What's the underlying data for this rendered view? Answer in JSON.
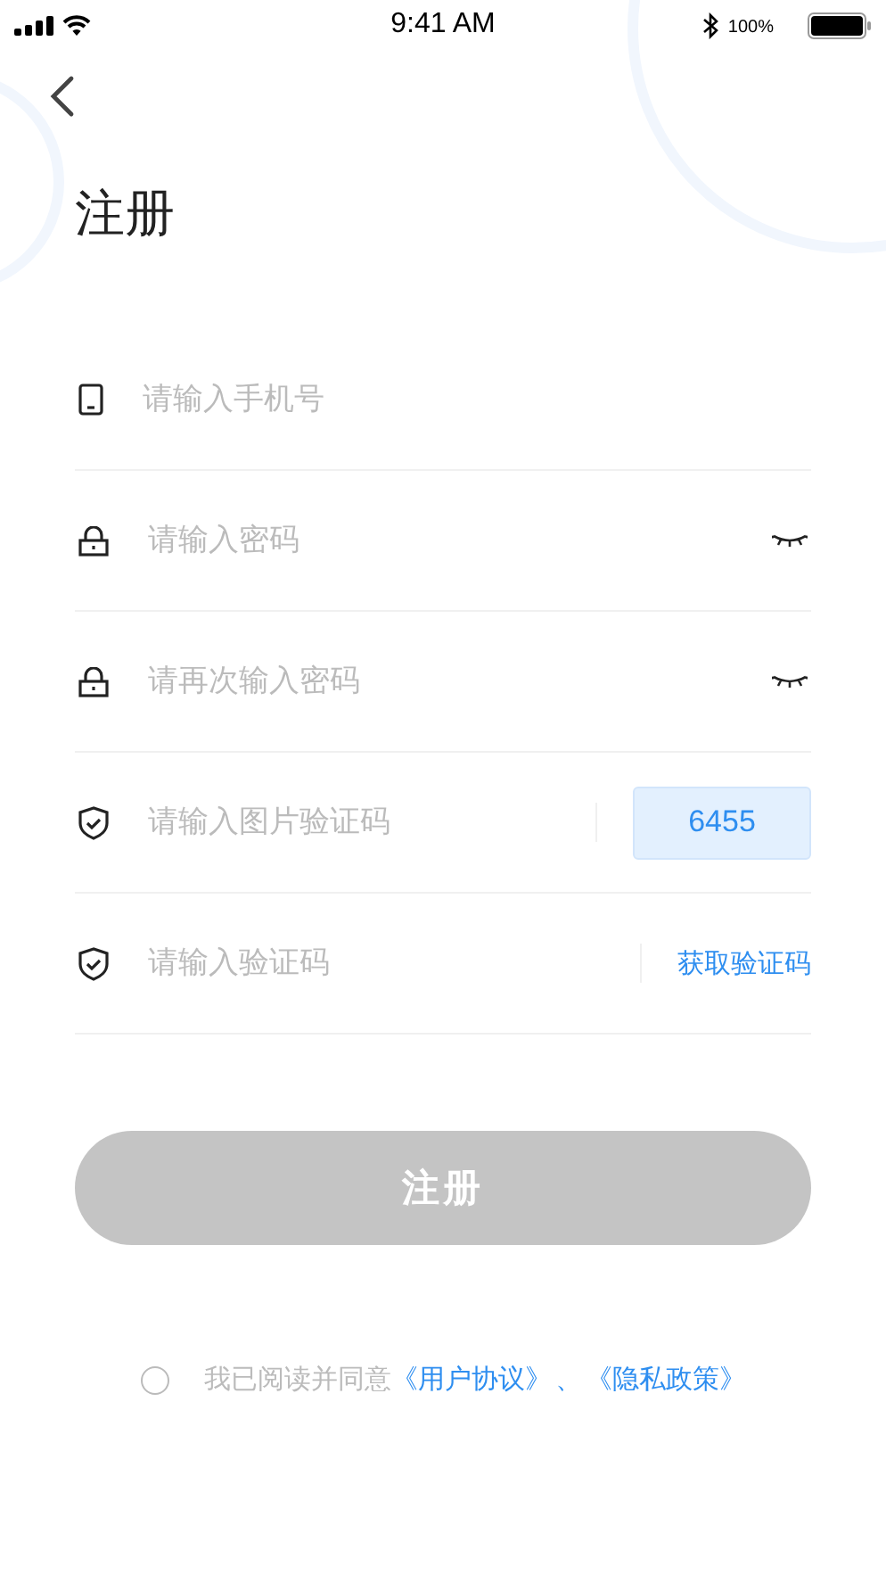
{
  "status_bar": {
    "time": "9:41 AM",
    "battery_percent": "100%"
  },
  "title": "注册",
  "fields": [
    {
      "kind": "phone",
      "placeholder": "请输入手机号"
    },
    {
      "kind": "password",
      "placeholder": "请输入密码"
    },
    {
      "kind": "password",
      "placeholder": "请再次输入密码"
    },
    {
      "kind": "captcha",
      "placeholder": "请输入图片验证码",
      "captcha": "6455"
    },
    {
      "kind": "sms",
      "placeholder": "请输入验证码",
      "action": "获取验证码"
    }
  ],
  "submit": {
    "label": "注册",
    "disabled": true
  },
  "agreement": {
    "checked": false,
    "text": "我已阅读并同意",
    "links": [
      "《用户协议》",
      "《隐私政策》"
    ],
    "separator": "、"
  }
}
